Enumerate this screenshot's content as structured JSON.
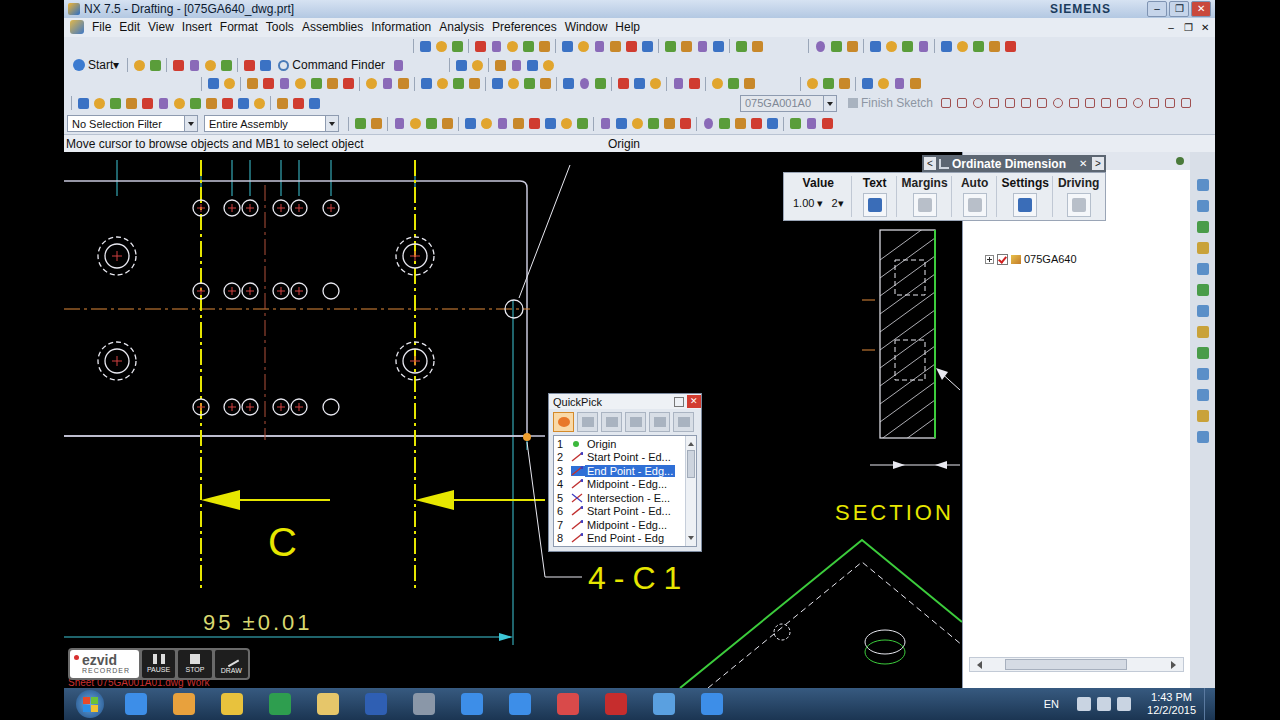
{
  "window": {
    "title": "NX 7.5 - Drafting - [075GA640_dwg.prt]",
    "brand": "SIEMENS",
    "controls": [
      "–",
      "❐",
      "✕"
    ]
  },
  "menu": {
    "items": [
      "File",
      "Edit",
      "View",
      "Insert",
      "Format",
      "Tools",
      "Assemblies",
      "Information",
      "Analysis",
      "Preferences",
      "Window",
      "Help"
    ],
    "controls": [
      "–",
      "❐",
      "✕"
    ]
  },
  "toolbar": {
    "start": "Start",
    "dropdown": "▾",
    "command_finder": "Command Finder",
    "sketch_name": "075GA001A0",
    "finish_sketch": "Finish Sketch",
    "finish_sketch_disabled": true
  },
  "selection": {
    "filter": "No Selection Filter",
    "scope": "Entire Assembly"
  },
  "status": {
    "prompt": "Move cursor to browse objects and MB1 to select object",
    "message": "Origin"
  },
  "drawing": {
    "section_label": "C",
    "chamfer_note": "4-C1",
    "dimension": "95 ±0.01",
    "view_label": "SECTION",
    "sheet_label": "Sheet 075GA001A01.dwg Work"
  },
  "ordinate_dimension": {
    "title": "Ordinate Dimension",
    "prev": "<",
    "next": ">",
    "close": "✕",
    "value": "1.00",
    "precision": "2",
    "groups": [
      {
        "label": "Value",
        "kind": "value",
        "disabled": false
      },
      {
        "label": "Text",
        "kind": "icon",
        "disabled": false
      },
      {
        "label": "Margins",
        "kind": "icon",
        "disabled": true
      },
      {
        "label": "Auto",
        "kind": "icon",
        "disabled": true
      },
      {
        "label": "Settings",
        "kind": "icon",
        "disabled": false
      },
      {
        "label": "Driving",
        "kind": "icon",
        "disabled": true
      }
    ]
  },
  "navigator": {
    "items": [
      {
        "label": "075GA640",
        "expanded": false,
        "checked": true
      }
    ]
  },
  "quickpick": {
    "title": "QuickPick",
    "close": "✕",
    "modes": [
      {
        "selected": true
      },
      {
        "selected": false
      },
      {
        "selected": false
      },
      {
        "selected": false
      },
      {
        "selected": false
      },
      {
        "selected": false
      }
    ],
    "items": [
      {
        "index": "1",
        "label": "Origin",
        "kind": "point",
        "selected": false
      },
      {
        "index": "2",
        "label": "Start Point - Ed...",
        "kind": "edge",
        "selected": false
      },
      {
        "index": "3",
        "label": "End Point - Edg...",
        "kind": "edge",
        "selected": true
      },
      {
        "index": "4",
        "label": "Midpoint - Edg...",
        "kind": "edge",
        "selected": false
      },
      {
        "index": "5",
        "label": "Intersection - E...",
        "kind": "intersection",
        "selected": false
      },
      {
        "index": "6",
        "label": "Start Point - Ed...",
        "kind": "edge",
        "selected": false
      },
      {
        "index": "7",
        "label": "Midpoint - Edg...",
        "kind": "edge",
        "selected": false
      },
      {
        "index": "8",
        "label": "End Point - Edg",
        "kind": "edge",
        "selected": false
      }
    ]
  },
  "recorder": {
    "brand": "ezvid",
    "subtitle": "RECORDER",
    "buttons": [
      "PAUSE",
      "STOP",
      "DRAW"
    ]
  },
  "taskbar": {
    "language": "EN",
    "time": "1:43 PM",
    "date": "12/2/2015"
  }
}
